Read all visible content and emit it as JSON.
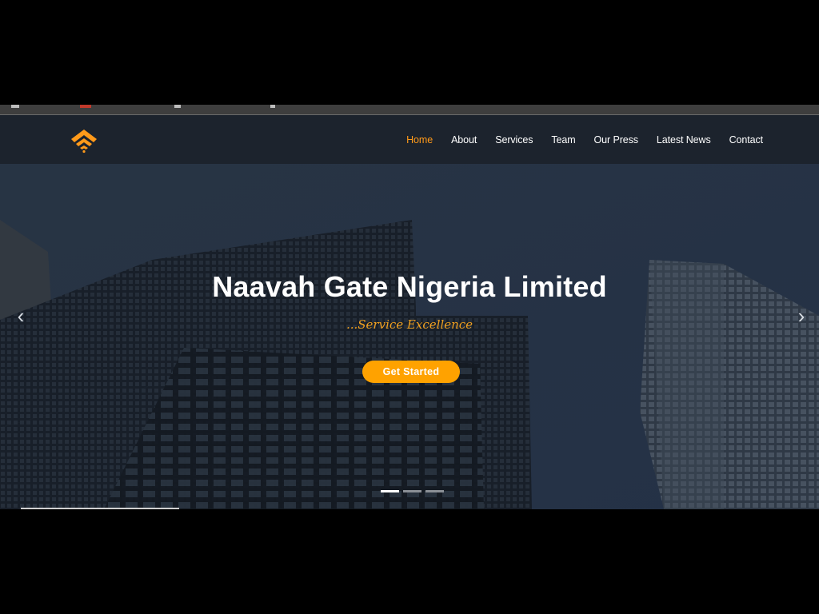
{
  "brand": {
    "logo_icon": "wifi-arch-logo-icon",
    "accent": "#ff9a1a"
  },
  "nav": {
    "items": [
      {
        "label": "Home",
        "active": true
      },
      {
        "label": "About",
        "active": false
      },
      {
        "label": "Services",
        "active": false
      },
      {
        "label": "Team",
        "active": false
      },
      {
        "label": "Our Press",
        "active": false
      },
      {
        "label": "Latest News",
        "active": false
      },
      {
        "label": "Contact",
        "active": false
      }
    ]
  },
  "hero": {
    "title": "Naavah Gate Nigeria Limited",
    "tagline": "...Service Excellence",
    "cta_label": "Get Started",
    "prev_icon": "chevron-left-icon",
    "next_icon": "chevron-right-icon",
    "slides_total": 3,
    "active_slide": 1,
    "cta_color": "#ffa200"
  }
}
